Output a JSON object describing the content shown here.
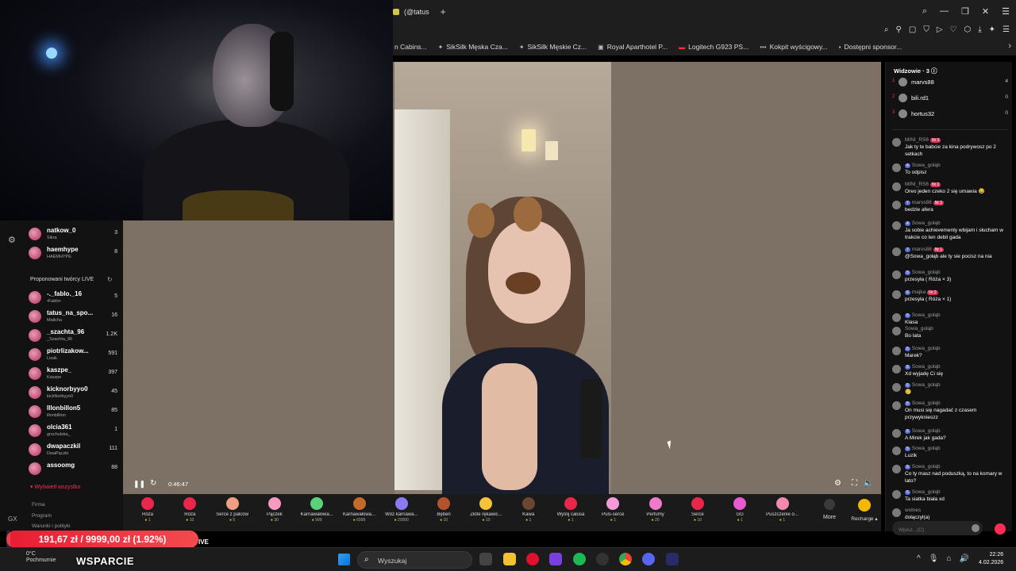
{
  "browser": {
    "tab_title": "(@tatus",
    "bookmarks": [
      {
        "label": "n Cabins..."
      },
      {
        "label": "SikSilk Męska Cza..."
      },
      {
        "label": "SikSilk Męskie Cz..."
      },
      {
        "label": "Royal Aparthotel P..."
      },
      {
        "label": "Logitech G923 PS..."
      },
      {
        "label": "Kokpit wyścigowy..."
      },
      {
        "label": "Dostępni sponsor..."
      }
    ]
  },
  "sidebar": {
    "followed": [
      {
        "name": "natkow_0",
        "sub": "Sikra",
        "count": "3"
      },
      {
        "name": "haemhype",
        "sub": "HAEMHYPE",
        "count": "8"
      }
    ],
    "suggested_header": "Proponowani twórcy LIVE",
    "suggested": [
      {
        "name": "-._fablo._16",
        "sub": "•Fablo•",
        "count": "5"
      },
      {
        "name": "tatus_na_spo...",
        "sub": "Malicha",
        "count": "16"
      },
      {
        "name": "_szachta_96",
        "sub": "_Szachta_96",
        "count": "1.2K"
      },
      {
        "name": "piotrlizakow...",
        "sub": "Lizak",
        "count": "591"
      },
      {
        "name": "kaszpe_",
        "sub": "Kaszpe",
        "count": "397"
      },
      {
        "name": "kicknorbyyo0",
        "sub": "kickNorbyyo0",
        "count": "45"
      },
      {
        "name": "lllonbillon5",
        "sub": "illonbillion",
        "count": "85"
      },
      {
        "name": "olcia361",
        "sub": "grochulska_",
        "count": "1"
      },
      {
        "name": "dwapaczkil",
        "sub": "DwaPączki",
        "count": "111"
      },
      {
        "name": "assoomg",
        "sub": "ㅤ",
        "count": "88"
      }
    ],
    "show_all": "Wyświetl wszystko",
    "footer": [
      "Firma",
      "Program",
      "Warunki i polityki"
    ],
    "gx_label": "GX"
  },
  "player": {
    "time": "0:46:47"
  },
  "gifts": [
    {
      "label": "Róża",
      "price": "1",
      "color": "#e8274b"
    },
    {
      "label": "Róża",
      "price": "10",
      "color": "#e8274b"
    },
    {
      "label": "Serce z palców",
      "price": "5",
      "color": "#f0a080"
    },
    {
      "label": "Pączek",
      "price": "30",
      "color": "#f59ac0"
    },
    {
      "label": "Karnawałowa...",
      "price": "999",
      "color": "#5bd17a"
    },
    {
      "label": "Karnawałowa...",
      "price": "6999",
      "color": "#c66a2a"
    },
    {
      "label": "Wóz karnawa...",
      "price": "20000",
      "color": "#8a7cf0"
    },
    {
      "label": "Bęben",
      "price": "10",
      "color": "#b3542d"
    },
    {
      "label": "Złote rękawic...",
      "price": "10",
      "color": "#f5c23a"
    },
    {
      "label": "Kawa",
      "price": "1",
      "color": "#6b4630"
    },
    {
      "label": "Wyślij całusa",
      "price": "1",
      "color": "#e8274b"
    },
    {
      "label": "Puls-serce",
      "price": "1",
      "color": "#f59ad8"
    },
    {
      "label": "Perfumy",
      "price": "20",
      "color": "#f07ac8"
    },
    {
      "label": "Serce",
      "price": "10",
      "color": "#e8274b"
    },
    {
      "label": "GG",
      "price": "1",
      "color": "#e85ad0"
    },
    {
      "label": "Puszczenie o...",
      "price": "1",
      "color": "#f08ab0"
    }
  ],
  "gift_more": "More",
  "gift_recharge": "Recharge",
  "viewers": {
    "header": "Widzowie",
    "count": "3",
    "list": [
      {
        "rank": "1",
        "name": "marvs88",
        "coins": "4"
      },
      {
        "rank": "2",
        "name": "bili.rd1",
        "coins": "0"
      },
      {
        "rank": "3",
        "name": "hortus32",
        "coins": "0"
      }
    ]
  },
  "chat": [
    {
      "user": "MINI_RS6",
      "lvl": "",
      "fan": "Nr 3",
      "text": "Jak ty te babcie za kina podrywosz po 2 setkach"
    },
    {
      "user": "Sowa_gołąb",
      "lvl": "4",
      "fan": "",
      "text": "To odpisz"
    },
    {
      "user": "MINI_RS6",
      "lvl": "",
      "fan": "Nr 2",
      "text": "Oreo jeden czeko 2 się umawia 😂"
    },
    {
      "user": "marvs88",
      "lvl": "7",
      "fan": "Nr 2",
      "text": "bedzie afera"
    },
    {
      "user": "Sowa_gołąb",
      "lvl": "4",
      "fan": "",
      "text": "Ja sobie achievementy wbijam i słucham w trakcie co ten debil gada"
    },
    {
      "user": "marvs88",
      "lvl": "7",
      "fan": "Nr 1",
      "text": "@Sowa_gołąb ale ty sie pocisz na nia"
    },
    {
      "user": "Sowa_gołąb",
      "lvl": "5",
      "fan": "",
      "text": "przesyła ( Róża × 3)"
    },
    {
      "user": "majka",
      "lvl": "6",
      "fan": "Nr 2",
      "text": "przesyła ( Róża × 1)"
    },
    {
      "user": "Sowa_gołąb",
      "lvl": "5",
      "fan": "",
      "text": "Klasa"
    },
    {
      "user": "Sowa_gołąb",
      "lvl": "",
      "fan": "",
      "text": "Bo lata"
    },
    {
      "user": "Sowa_gołąb",
      "lvl": "5",
      "fan": "",
      "text": "Marek?"
    },
    {
      "user": "Sowa_gołąb",
      "lvl": "5",
      "fan": "",
      "text": "Xd wyjadę Ci się"
    },
    {
      "user": "Sowa_gołąb",
      "lvl": "5",
      "fan": "",
      "text": "🥲"
    },
    {
      "user": "Sowa_gołąb",
      "lvl": "5",
      "fan": "",
      "text": "On musi się nagadać z czasem przywyknieszz"
    },
    {
      "user": "Sowa_gołąb",
      "lvl": "5",
      "fan": "",
      "text": "A Mirek jak gada?"
    },
    {
      "user": "Sowa_gołąb",
      "lvl": "5",
      "fan": "",
      "text": "Luzik"
    },
    {
      "user": "Sowa_gołąb",
      "lvl": "5",
      "fan": "",
      "text": "Co ty masz nad poduszką, to na komary w lato?"
    },
    {
      "user": "Sowa_gołąb",
      "lvl": "5",
      "fan": "",
      "text": "Ta siatka biała xd"
    },
    {
      "user": "wolnes",
      "lvl": "",
      "fan": "",
      "text": "dołączył(a)"
    }
  ],
  "chat_input_placeholder": "Wpisz...(C)",
  "donation": {
    "text": "191,67 zł / 9999,00 zł (1.92%)",
    "progress": 0.0192
  },
  "live_fragment": "IVE",
  "taskbar": {
    "temp": "0°C",
    "weather": "Pochmurnie",
    "wsparcie": "WSPARCIE",
    "search_label": "Wyszukaj",
    "time": "22:26",
    "date": "4.02.2026"
  }
}
